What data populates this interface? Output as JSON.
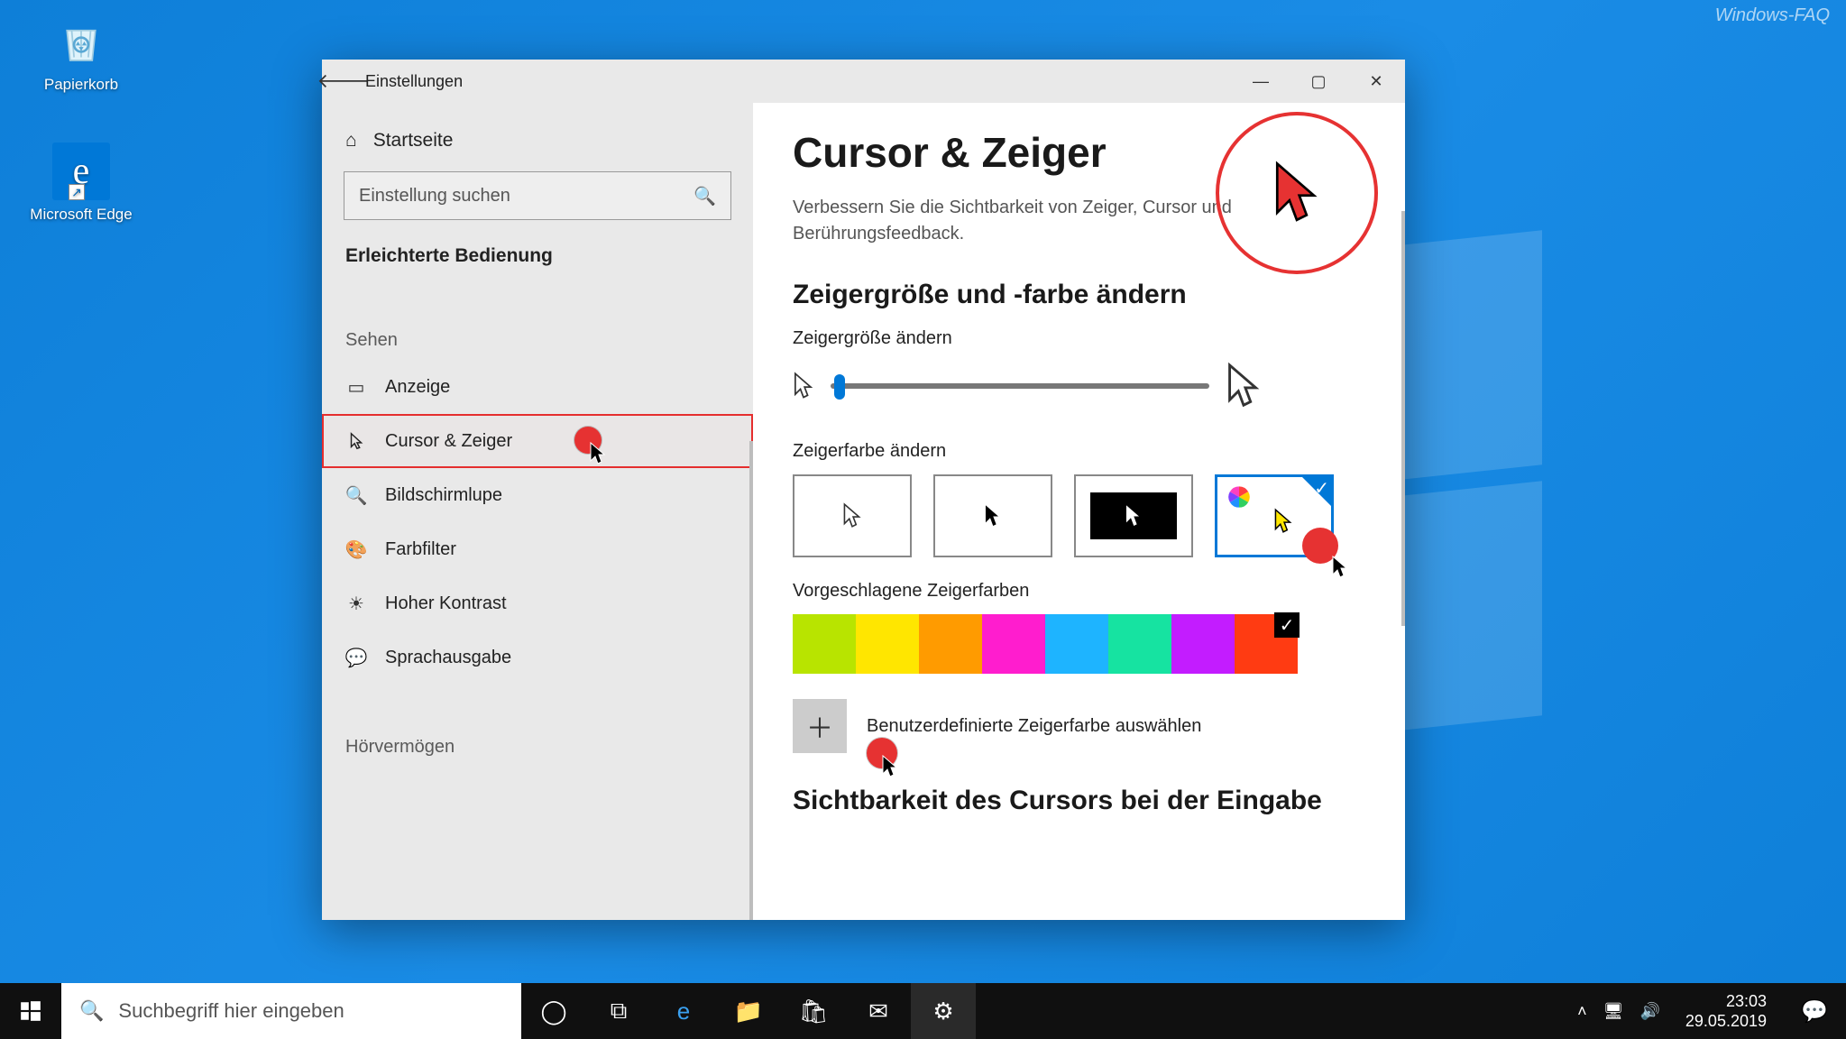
{
  "watermark": "Windows-FAQ",
  "desktop": {
    "recycle_label": "Papierkorb",
    "edge_label": "Microsoft Edge"
  },
  "window": {
    "title": "Einstellungen",
    "sidebar": {
      "home": "Startseite",
      "search_placeholder": "Einstellung suchen",
      "category": "Erleichterte Bedienung",
      "group_vision": "Sehen",
      "group_hearing": "Hörvermögen",
      "items": [
        {
          "label": "Anzeige"
        },
        {
          "label": "Cursor & Zeiger"
        },
        {
          "label": "Bildschirmlupe"
        },
        {
          "label": "Farbfilter"
        },
        {
          "label": "Hoher Kontrast"
        },
        {
          "label": "Sprachausgabe"
        }
      ]
    },
    "content": {
      "heading": "Cursor & Zeiger",
      "description": "Verbessern Sie die Sichtbarkeit von Zeiger, Cursor und Berührungsfeedback.",
      "section_size_color": "Zeigergröße und -farbe ändern",
      "pointer_size_label": "Zeigergröße ändern",
      "pointer_color_label": "Zeigerfarbe ändern",
      "suggested_colors_label": "Vorgeschlagene Zeigerfarben",
      "custom_color_label": "Benutzerdefinierte Zeigerfarbe auswählen",
      "section_cursor_visibility": "Sichtbarkeit des Cursors bei der Eingabe",
      "suggested_colors": [
        "#b8e400",
        "#ffe600",
        "#ff9b00",
        "#ff1dce",
        "#1eb4ff",
        "#16e3a1",
        "#c31cff",
        "#ff3b12"
      ],
      "selected_color_index": 7
    }
  },
  "taskbar": {
    "search_placeholder": "Suchbegriff hier eingeben",
    "time": "23:03",
    "date": "29.05.2019"
  }
}
